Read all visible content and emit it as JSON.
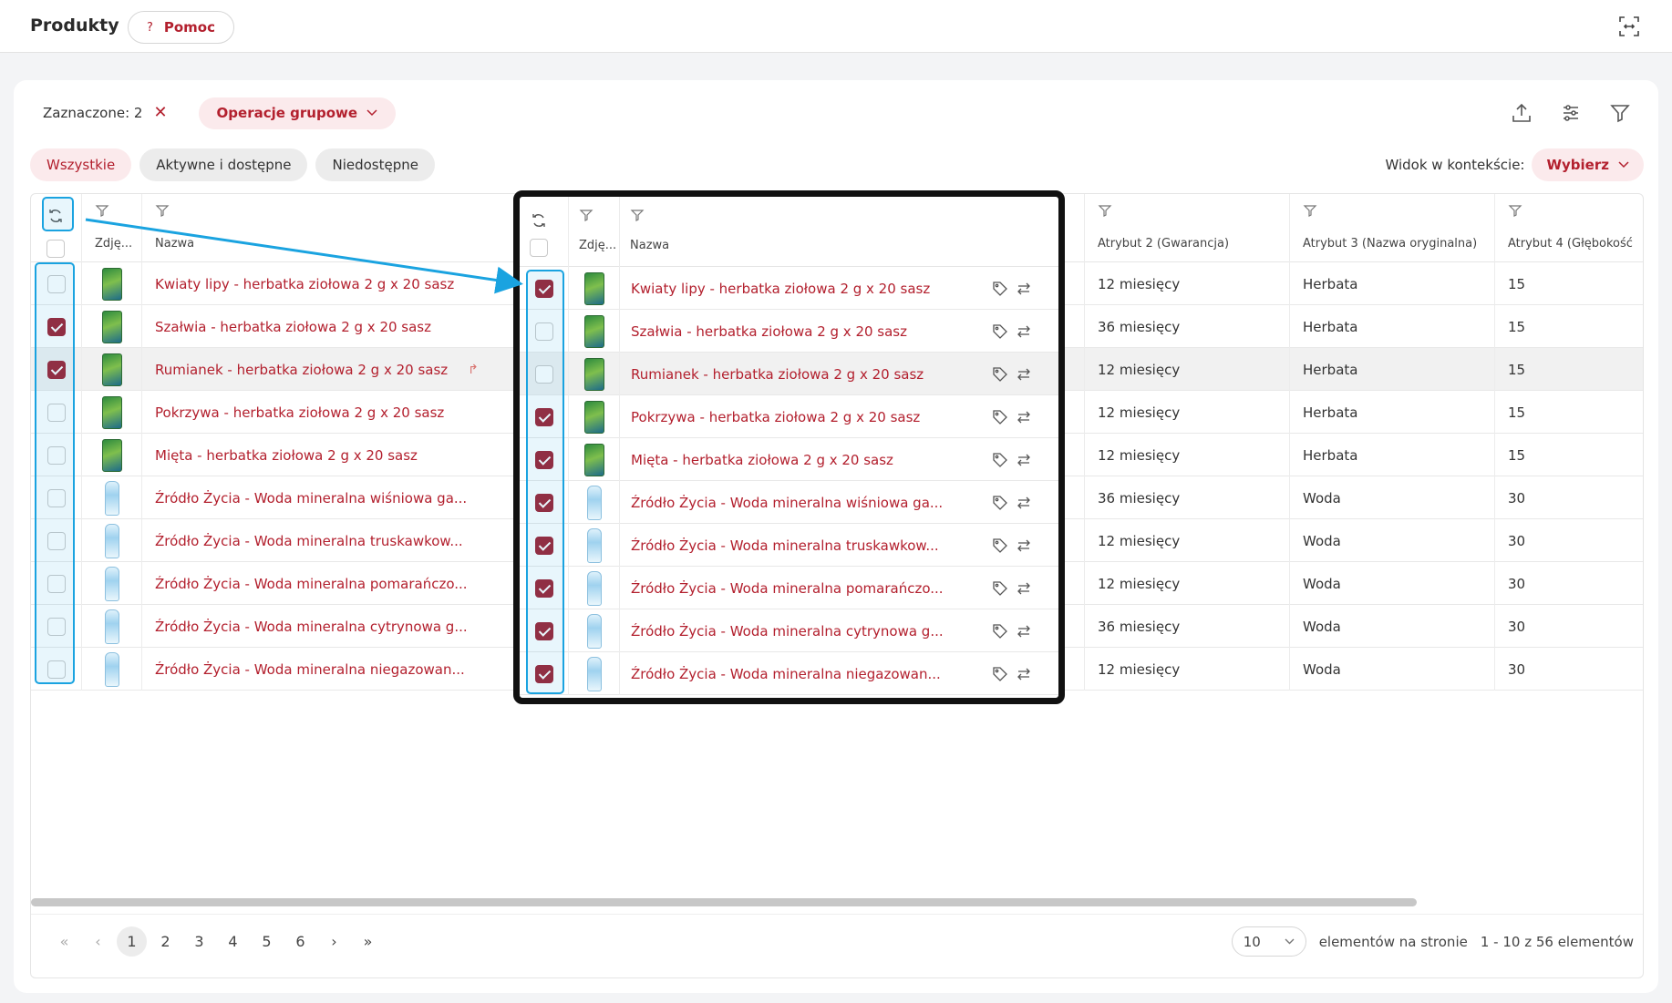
{
  "header": {
    "title": "Produkty",
    "help_label": "Pomoc",
    "help_icon": "?"
  },
  "toolbar": {
    "selected_label": "Zaznaczone: 2",
    "group_ops_label": "Operacje grupowe"
  },
  "filters": [
    "Wszystkie",
    "Aktywne i dostępne",
    "Niedostępne"
  ],
  "context": {
    "label": "Widok w kontekście:",
    "button": "Wybierz"
  },
  "columns": {
    "photo": "Zdję...",
    "name": "Nazwa",
    "attr2": "Atrybut 2 (Gwarancja)",
    "attr3": "Atrybut 3 (Nazwa oryginalna)",
    "attr4": "Atrybut 4 (Głębokość"
  },
  "rows": [
    {
      "name": "Kwiaty lipy - herbatka ziołowa 2 g x 20 sasz",
      "attr2": "12 miesięcy",
      "attr3": "Herbata",
      "attr4": "15",
      "checked": false,
      "zoom_checked": true,
      "kind": "tea"
    },
    {
      "name": "Szałwia - herbatka ziołowa 2 g x 20 sasz",
      "attr2": "36 miesięcy",
      "attr3": "Herbata",
      "attr4": "15",
      "checked": true,
      "zoom_checked": false,
      "kind": "tea"
    },
    {
      "name": "Rumianek - herbatka ziołowa 2 g x 20 sasz",
      "attr2": "12 miesięcy",
      "attr3": "Herbata",
      "attr4": "15",
      "checked": true,
      "zoom_checked": false,
      "kind": "tea"
    },
    {
      "name": "Pokrzywa - herbatka ziołowa 2 g x 20 sasz",
      "attr2": "12 miesięcy",
      "attr3": "Herbata",
      "attr4": "15",
      "checked": false,
      "zoom_checked": true,
      "kind": "tea"
    },
    {
      "name": "Mięta - herbatka ziołowa 2 g x 20 sasz",
      "attr2": "12 miesięcy",
      "attr3": "Herbata",
      "attr4": "15",
      "checked": false,
      "zoom_checked": true,
      "kind": "tea"
    },
    {
      "name": "Źródło Życia - Woda mineralna wiśniowa ga...",
      "attr2": "36 miesięcy",
      "attr3": "Woda",
      "attr4": "30",
      "checked": false,
      "zoom_checked": true,
      "kind": "water"
    },
    {
      "name": "Źródło Życia - Woda mineralna truskawkow...",
      "attr2": "12 miesięcy",
      "attr3": "Woda",
      "attr4": "30",
      "checked": false,
      "zoom_checked": true,
      "kind": "water"
    },
    {
      "name": "Źródło Życia - Woda mineralna pomarańczo...",
      "attr2": "12 miesięcy",
      "attr3": "Woda",
      "attr4": "30",
      "checked": false,
      "zoom_checked": true,
      "kind": "water"
    },
    {
      "name": "Źródło Życia - Woda mineralna cytrynowa g...",
      "attr2": "36 miesięcy",
      "attr3": "Woda",
      "attr4": "30",
      "checked": false,
      "zoom_checked": true,
      "kind": "water"
    },
    {
      "name": "Źródło Życia - Woda mineralna niegazowan...",
      "attr2": "12 miesięcy",
      "attr3": "Woda",
      "attr4": "30",
      "checked": false,
      "zoom_checked": true,
      "kind": "water"
    }
  ],
  "pagination": {
    "pages": [
      "1",
      "2",
      "3",
      "4",
      "5",
      "6"
    ],
    "current": "1",
    "per_page": "10",
    "per_page_label": "elementów na stronie",
    "range_label": "1 - 10 z 56 elementów"
  },
  "colors": {
    "accent": "#b3202e",
    "checkbox": "#9e2233",
    "highlight": "#1aa3e0"
  }
}
